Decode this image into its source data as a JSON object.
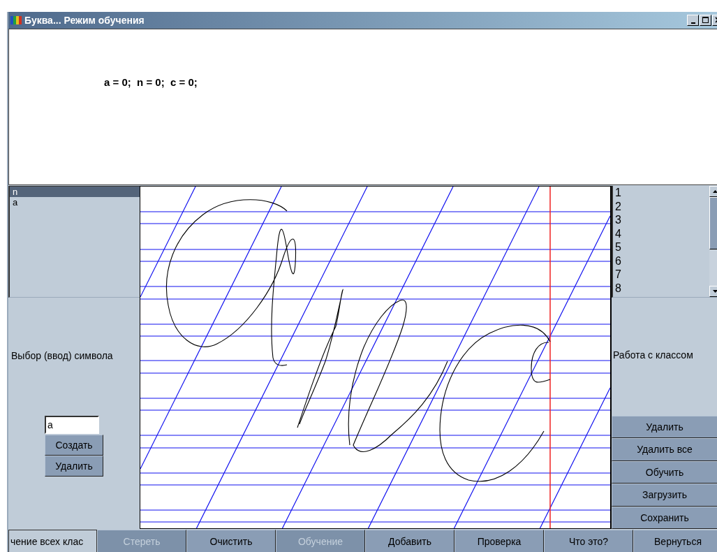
{
  "window": {
    "title": "Буква... Режим обучения"
  },
  "counts_text": "a = 0;  n = 0;  c = 0;",
  "symbols": {
    "items": [
      {
        "label": "n",
        "selected": true
      },
      {
        "label": "a",
        "selected": false
      }
    ],
    "label": "Выбор (ввод) символа",
    "input_value": "a",
    "buttons": [
      {
        "label": "Создать"
      },
      {
        "label": "Удалить"
      }
    ]
  },
  "classes": {
    "items": [
      {
        "label": "1"
      },
      {
        "label": "2"
      },
      {
        "label": "3"
      },
      {
        "label": "4"
      },
      {
        "label": "5"
      },
      {
        "label": "6"
      },
      {
        "label": "7"
      },
      {
        "label": "8"
      }
    ],
    "label": "Работа с классом",
    "buttons": [
      {
        "label": "Удалить"
      },
      {
        "label": "Удалить все"
      },
      {
        "label": "Обучить"
      },
      {
        "label": "Загрузить"
      },
      {
        "label": "Сохранить"
      }
    ]
  },
  "bottom_buttons": [
    {
      "label": "чение всех клас",
      "disabled": false
    },
    {
      "label": "Стереть",
      "disabled": true
    },
    {
      "label": "Очистить",
      "disabled": false
    },
    {
      "label": "Обучение",
      "disabled": true
    },
    {
      "label": "Добавить",
      "disabled": false
    },
    {
      "label": "Проверка",
      "disabled": false
    },
    {
      "label": "Что это?",
      "disabled": false
    },
    {
      "label": "Вернуться",
      "disabled": false
    }
  ]
}
